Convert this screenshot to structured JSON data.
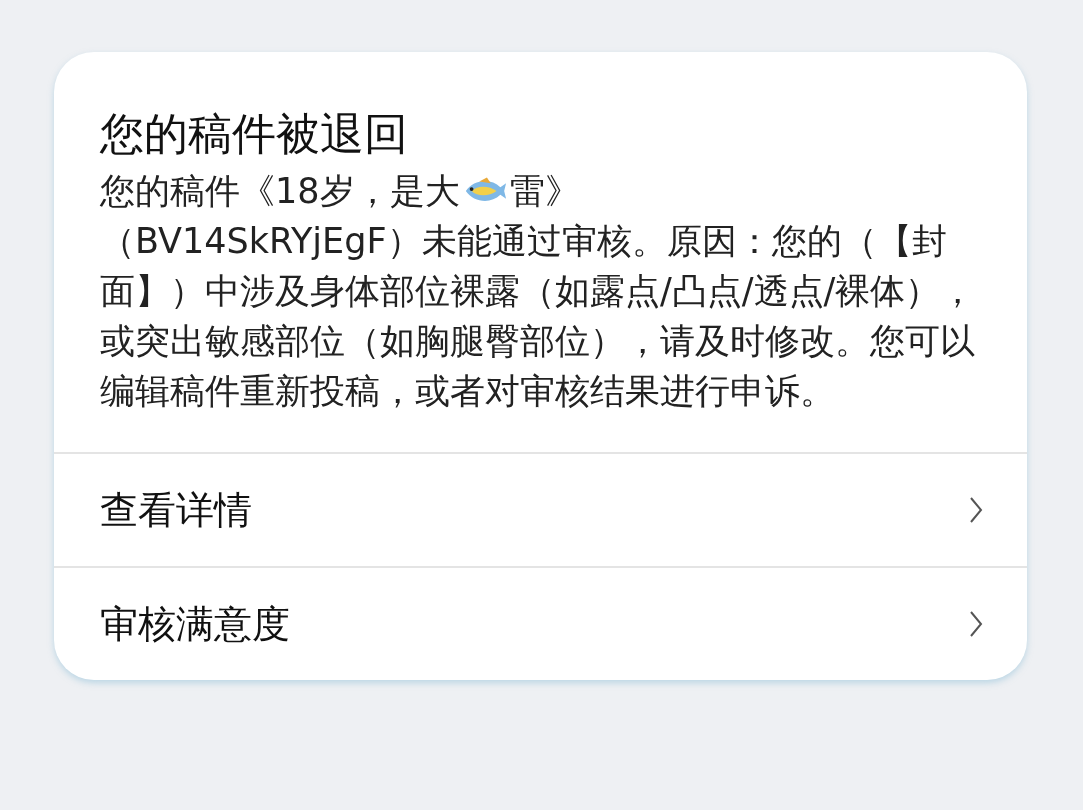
{
  "card": {
    "title": "您的稿件被退回",
    "message": {
      "before": "您的稿件《18岁，是大",
      "after": "雷》",
      "rest": "（BV14SkRYjEgF）未能通过审核。原因：您的（【封面】）中涉及身体部位裸露（如露点/凸点/透点/裸体），或突出敏感部位（如胸腿臀部位），请及时修改。您可以编辑稿件重新投稿，或者对审核结果进行申诉。"
    },
    "actions": [
      {
        "label": "查看详情"
      },
      {
        "label": "审核满意度"
      }
    ]
  }
}
